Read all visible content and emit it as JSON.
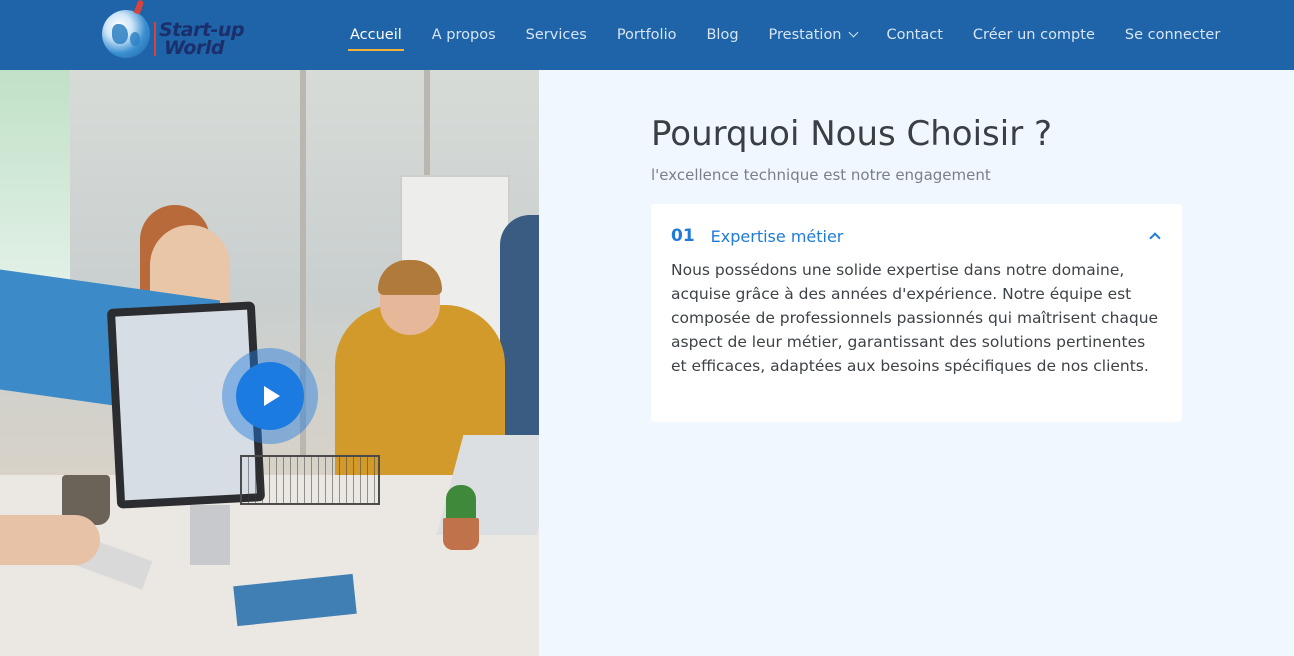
{
  "header": {
    "logo_line1": "Start-up",
    "logo_line2": "World",
    "nav": [
      {
        "label": "Accueil",
        "active": true
      },
      {
        "label": "A propos"
      },
      {
        "label": "Services"
      },
      {
        "label": "Portfolio"
      },
      {
        "label": "Blog"
      },
      {
        "label": "Prestation",
        "dropdown": true
      },
      {
        "label": "Contact"
      },
      {
        "label": "Créer un compte"
      },
      {
        "label": "Se connecter"
      }
    ]
  },
  "main": {
    "title": "Pourquoi Nous Choisir ?",
    "subtitle": "l'excellence technique est notre engagement",
    "accordion": [
      {
        "number": "01",
        "title": "Expertise métier",
        "body": "Nous possédons une solide expertise dans notre domaine, acquise grâce à des années d'expérience. Notre équipe est composée de professionnels passionnés qui maîtrisent chaque aspect de leur métier, garantissant des solutions pertinentes et efficaces, adaptées aux besoins spécifiques de nos clients.",
        "expanded": true
      }
    ]
  },
  "colors": {
    "header_bg": "#1f63a8",
    "accent": "#1f7ad8",
    "active_underline": "#f0b23a",
    "page_bg": "#f1f7fe"
  },
  "icons": {
    "play": "play-icon",
    "collapse": "chevron-up-icon",
    "dropdown": "chevron-down-icon"
  }
}
